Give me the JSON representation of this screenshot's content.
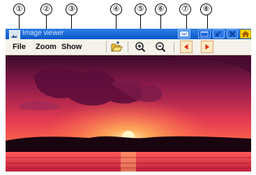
{
  "callouts": [
    "①",
    "②",
    "③",
    "④",
    "⑤",
    "⑥",
    "⑦",
    "⑧"
  ],
  "window": {
    "title": "Image viewer"
  },
  "menu": {
    "file": "File",
    "zoom": "Zoom",
    "show": "Show"
  },
  "toolbar": {
    "open_icon": "folder-open-icon",
    "zoom_in_icon": "zoom-in-icon",
    "zoom_out_icon": "zoom-out-icon",
    "prev_icon": "previous-arrow-icon",
    "next_icon": "next-arrow-icon"
  },
  "colors": {
    "title_bar": "#0a56c8",
    "menubar": "#f4f2ea",
    "nav_button": "#ffe9c4",
    "nav_arrow": "#e03010"
  },
  "image": {
    "subject": "sunset-photo"
  }
}
